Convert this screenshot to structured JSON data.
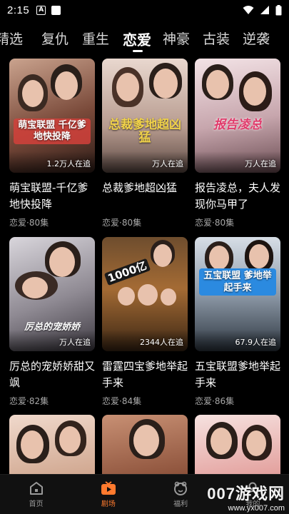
{
  "status": {
    "time": "2:15",
    "a_label": "A"
  },
  "tabs": [
    {
      "label": "精选"
    },
    {
      "label": "复仇"
    },
    {
      "label": "重生"
    },
    {
      "label": "恋爱"
    },
    {
      "label": "神豪"
    },
    {
      "label": "古装"
    },
    {
      "label": "逆袭"
    }
  ],
  "active_tab": "恋爱",
  "dramas": [
    {
      "title": "萌宝联盟-千亿爹地快投降",
      "meta": "恋爱·80集",
      "views": "1.2万人在追",
      "poster_text": "萌宝联盟 千亿爹地快投降",
      "accent": "#d2413b"
    },
    {
      "title": "总裁爹地超凶猛",
      "meta": "恋爱·80集",
      "views": "万人在追",
      "poster_text": "总裁爹地超凶猛",
      "accent": "#f0d24a"
    },
    {
      "title": "报告凌总，夫人发现你马甲了",
      "meta": "恋爱·80集",
      "views": "万人在追",
      "poster_text": "报告凌总",
      "accent": "#e13a6b"
    },
    {
      "title": "厉总的宠娇娇甜又飒",
      "meta": "恋爱·82集",
      "views": "万人在追",
      "poster_text": "厉总的宠娇娇",
      "accent": "#c9c9d6"
    },
    {
      "title": "雷霆四宝爹地举起手来",
      "meta": "恋爱·84集",
      "views": "2344人在追",
      "poster_text": "1000亿",
      "accent": "#e6a829"
    },
    {
      "title": "五宝联盟爹地举起手来",
      "meta": "恋爱·86集",
      "views": "67.9人在追",
      "poster_text": "五宝联盟 爹地举起手来",
      "accent": "#2b8ae0"
    },
    {
      "title": "",
      "meta": "",
      "views": "",
      "poster_text": "",
      "accent": "#cfa58d"
    },
    {
      "title": "",
      "meta": "",
      "views": "",
      "poster_text": "",
      "accent": "#b06a4b"
    },
    {
      "title": "",
      "meta": "",
      "views": "",
      "poster_text": "",
      "accent": "#e4a3a0"
    }
  ],
  "nav": [
    {
      "label": "首页",
      "icon": "home-icon"
    },
    {
      "label": "剧场",
      "icon": "theater-icon"
    },
    {
      "label": "福利",
      "icon": "welfare-icon"
    },
    {
      "label": "我的",
      "icon": "profile-icon"
    }
  ],
  "watermark": {
    "big": "007游戏网",
    "small": "www.yx007.com"
  },
  "colors": {
    "accent": "#ff7a2e",
    "background": "#000000",
    "meta": "#a8a8a8"
  }
}
